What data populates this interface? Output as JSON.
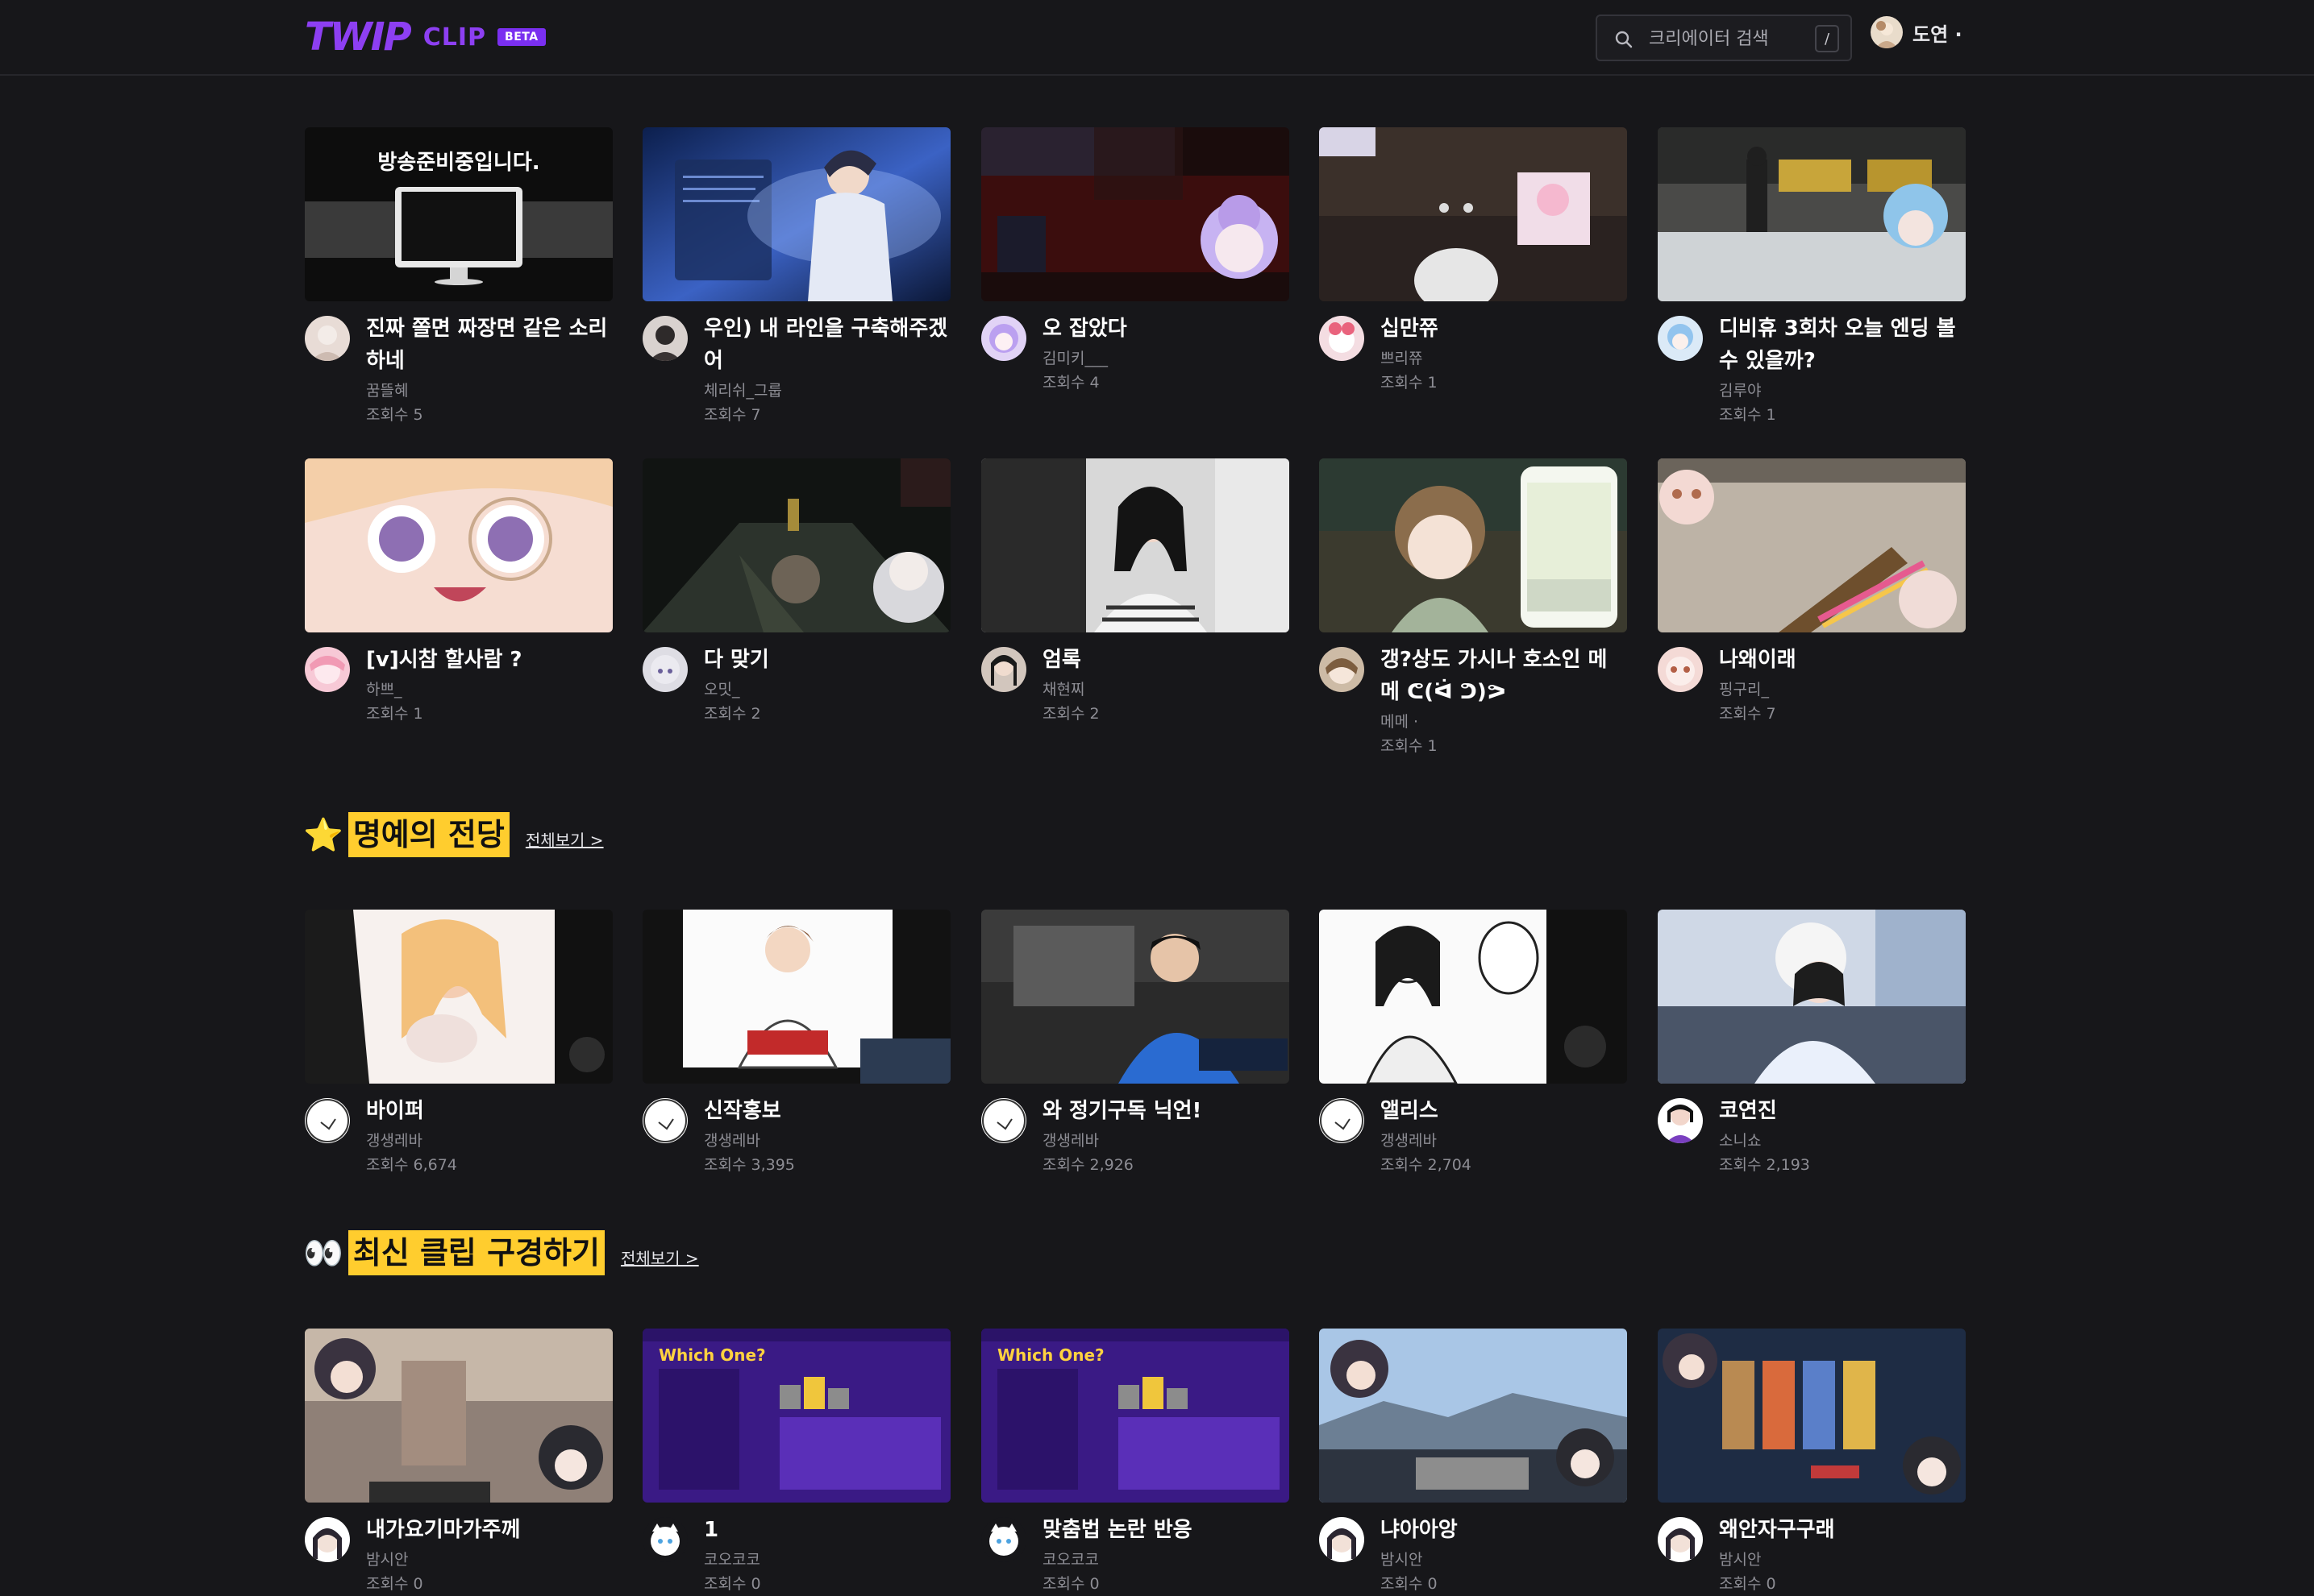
{
  "header": {
    "logo_main": "TWIP",
    "logo_sub": "CLIP",
    "logo_badge": "BETA",
    "search_placeholder": "크리에이터 검색",
    "search_shortcut": "/",
    "user_name": "도연 ·"
  },
  "top_clips": [
    {
      "title": "진짜 쫄면 짜장면 같은 소리 하네",
      "creator": "꿈뜰혜",
      "views": "조회수 5",
      "thumb_text": "방송준비중입니다."
    },
    {
      "title": "우인) 내 라인을 구축해주겠어",
      "creator": "체리쉬_그룹",
      "views": "조회수 7"
    },
    {
      "title": "오 잡았다",
      "creator": "김미키___",
      "views": "조회수 4"
    },
    {
      "title": "십만쮸",
      "creator": "쁘리쮸",
      "views": "조회수 1"
    },
    {
      "title": "디비휴 3회차 오늘 엔딩 볼 수 있을까?",
      "creator": "김루야",
      "views": "조회수 1"
    },
    {
      "title": "[v]시참 할사람 ?",
      "creator": "하쁘_",
      "views": "조회수 1"
    },
    {
      "title": "다 맞기",
      "creator": "오밋_",
      "views": "조회수 2"
    },
    {
      "title": "엄록",
      "creator": "채현찌",
      "views": "조회수 2"
    },
    {
      "title": "갱?상도 가시나 호소인 메메 ᕦ(ᐛ ᕤ)ᕗ",
      "creator": "메메 ·",
      "views": "조회수 1"
    },
    {
      "title": "나왜이래",
      "creator": "핑구리_",
      "views": "조회수 7"
    }
  ],
  "hall_of_fame": {
    "icon": "⭐",
    "title": "명예의 전당",
    "more": "전체보기 >",
    "clips": [
      {
        "title": "바이퍼",
        "creator": "갱생레바",
        "views": "조회수 6,674"
      },
      {
        "title": "신작홍보",
        "creator": "갱생레바",
        "views": "조회수 3,395"
      },
      {
        "title": "와 정기구독 닉언!",
        "creator": "갱생레바",
        "views": "조회수 2,926"
      },
      {
        "title": "앨리스",
        "creator": "갱생레바",
        "views": "조회수 2,704"
      },
      {
        "title": "코연진",
        "creator": "소니쇼",
        "views": "조회수 2,193"
      }
    ]
  },
  "latest": {
    "icon": "👀",
    "title": "최신 클립 구경하기",
    "more": "전체보기 >",
    "clips": [
      {
        "title": "내가요기마가주께",
        "creator": "밤시안",
        "views": "조회수 0"
      },
      {
        "title": "1",
        "creator": "코오코코",
        "views": "조회수 0",
        "thumb_text": "Which One?"
      },
      {
        "title": "맞춤법 논란 반응",
        "creator": "코오코코",
        "views": "조회수 0",
        "thumb_text": "Which One?"
      },
      {
        "title": "냐아아앙",
        "creator": "밤시안",
        "views": "조회수 0"
      },
      {
        "title": "왜안자구구래",
        "creator": "밤시안",
        "views": "조회수 0"
      }
    ]
  },
  "colors": {
    "background": "#17171a",
    "brand_purple": "#8d3ff2",
    "section_highlight": "#ffcd2e",
    "meta_text": "#8d8d94"
  }
}
